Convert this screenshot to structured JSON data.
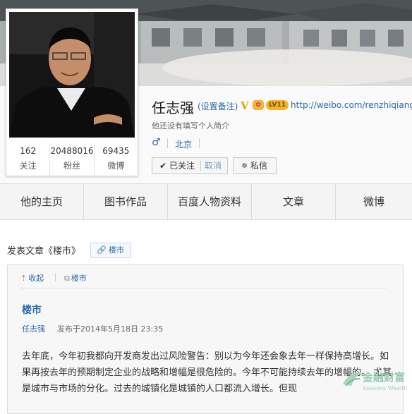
{
  "profile": {
    "name": "任志强",
    "set_note": "(设置备注)",
    "v_badge": "V",
    "badge_level": "LV11",
    "homepage_url": "http://weibo.com/renzhiqiang",
    "intro": "他还没有填写个人简介",
    "gender_symbol": "♂",
    "city": "北京",
    "followed_label": "已关注",
    "cancel_label": "取消",
    "message_label": "私信",
    "stats": [
      {
        "value": "162",
        "label": "关注"
      },
      {
        "value": "20488016",
        "label": "粉丝"
      },
      {
        "value": "69435",
        "label": "微博"
      }
    ]
  },
  "tabs": [
    "他的主页",
    "图书作品",
    "百度人物资料",
    "文章",
    "微博"
  ],
  "article_section": {
    "heading": "发表文章《楼市》",
    "tag_label": "楼市",
    "collapse_label": "收起",
    "external_label": "楼市",
    "title": "楼市",
    "author": "任志强",
    "published": "发布于2014年5月18日 23:35",
    "body": "去年底，今年初我都向开发商发出过风险警告：别以为今年还会象去年一样保持高增长。如果再按去年的预期制定企业的战略和增幅是很危险的。今年不可能持续去年的增幅的。 尤其是城市与市场的分化。过去的城镇化是城镇的人口都流入增长。但现"
  },
  "watermark": {
    "name": "金融财富",
    "sub": "Seasons Wealth"
  },
  "colors": {
    "link": "#2a6aa8",
    "v_badge": "#e8a500",
    "tab_bg": "#f4f4f4",
    "panel_bg": "#f7f7f7"
  },
  "icons": [
    "check-icon",
    "message-icon",
    "link-icon",
    "up-arrow-icon",
    "external-link-icon"
  ]
}
